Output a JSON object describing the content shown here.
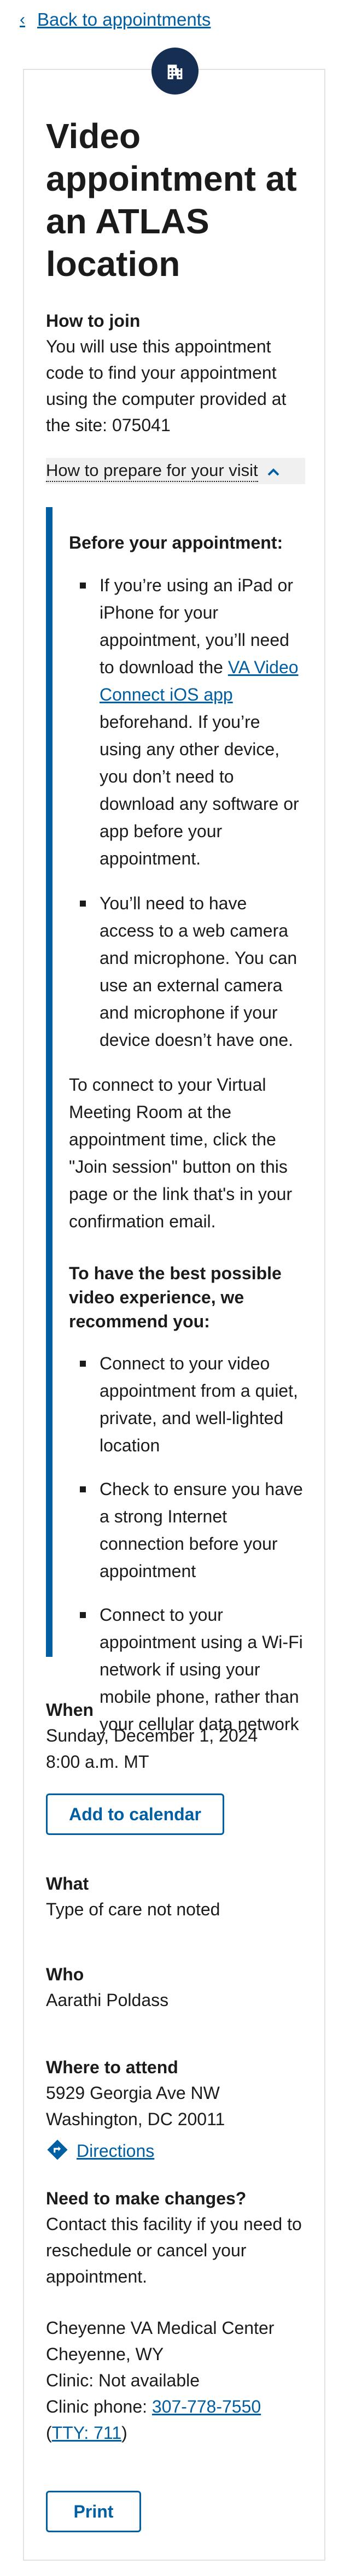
{
  "back_link": {
    "icon": "chevron-left-icon",
    "label": "Back to appointments"
  },
  "header": {
    "icon": "building-icon",
    "title": "Video appointment at an ATLAS location"
  },
  "how_to_join": {
    "heading": "How to join",
    "text": "You will use this appointment code to find your appointment using the computer provided at the site: 075041"
  },
  "prepare": {
    "toggle_label": "How to prepare for your visit",
    "toggle_icon": "chevron-up-icon",
    "before_heading": "Before your appointment:",
    "bullet1_part1": "If you’re using an iPad or iPhone for your appointment, you’ll need to download the ",
    "bullet1_link": "VA Video Connect iOS app",
    "bullet1_part2": " beforehand. If you’re using any other device, you don’t need to download any software or app before your appointment.",
    "bullet2": "You’ll need to have access to a web camera and microphone. You can use an external camera and microphone if your device doesn’t have one.",
    "connect_text": "To connect to your Virtual Meeting Room at the appointment time, click the \"Join session\" button on this page or the link that's in your confirmation email.",
    "best_heading": "To have the best possible video experience, we recommend you:",
    "recommend": [
      "Connect to your video appointment from a quiet, private, and well-lighted location",
      "Check to ensure you have a strong Internet connection before your appointment",
      "Connect to your appointment using a Wi-Fi network if using your mobile phone, rather than your cellular data network"
    ]
  },
  "when": {
    "heading": "When",
    "date": "Sunday, December 1, 2024",
    "time": "8:00 a.m. MT",
    "calendar_button": "Add to calendar"
  },
  "what": {
    "heading": "What",
    "value": "Type of care not noted"
  },
  "who": {
    "heading": "Who",
    "value": "Aarathi Poldass"
  },
  "where": {
    "heading": "Where to attend",
    "line1": "5929 Georgia Ave NW",
    "line2": "Washington, DC 20011",
    "directions_icon": "directions-icon",
    "directions_label": "Directions"
  },
  "changes": {
    "heading": "Need to make changes?",
    "text": "Contact this facility if you need to reschedule or cancel your appointment.",
    "facility": "Cheyenne VA Medical Center",
    "city": "Cheyenne, WY",
    "clinic": "Clinic: Not available",
    "phone_label": "Clinic phone: ",
    "phone": "307-778-7550",
    "tty_open": "(",
    "tty": "TTY: 711",
    "tty_close": ")"
  },
  "print_button": "Print",
  "colors": {
    "primary": "#005ea2",
    "icon_bg": "#162e51",
    "border": "#dfe1e2"
  }
}
